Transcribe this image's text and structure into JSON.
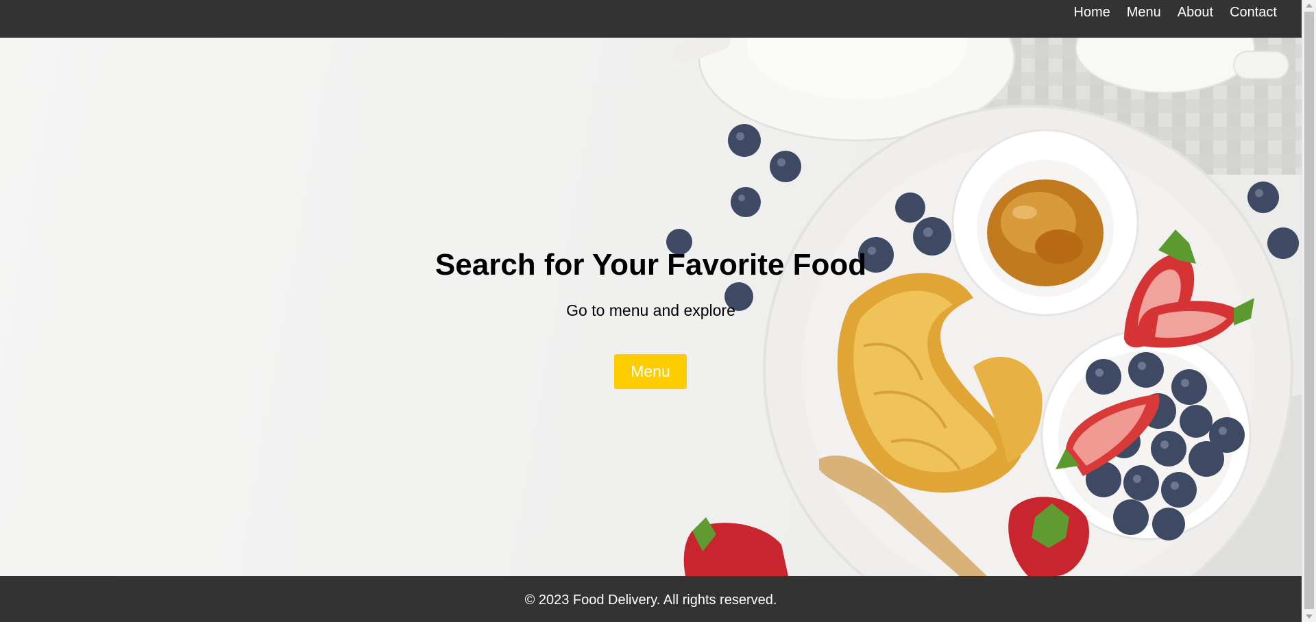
{
  "nav": {
    "items": [
      {
        "label": "Home"
      },
      {
        "label": "Menu"
      },
      {
        "label": "About"
      },
      {
        "label": "Contact"
      }
    ]
  },
  "hero": {
    "title": "Search for Your Favorite Food",
    "subtitle": "Go to menu and explore",
    "button_label": "Menu",
    "background_image": "breakfast-plate-photo"
  },
  "footer": {
    "text": "© 2023 Food Delivery. All rights reserved."
  },
  "colors": {
    "header_bg": "#333333",
    "footer_bg": "#333333",
    "button_bg": "#ffcc00",
    "button_text": "#ffffff"
  }
}
